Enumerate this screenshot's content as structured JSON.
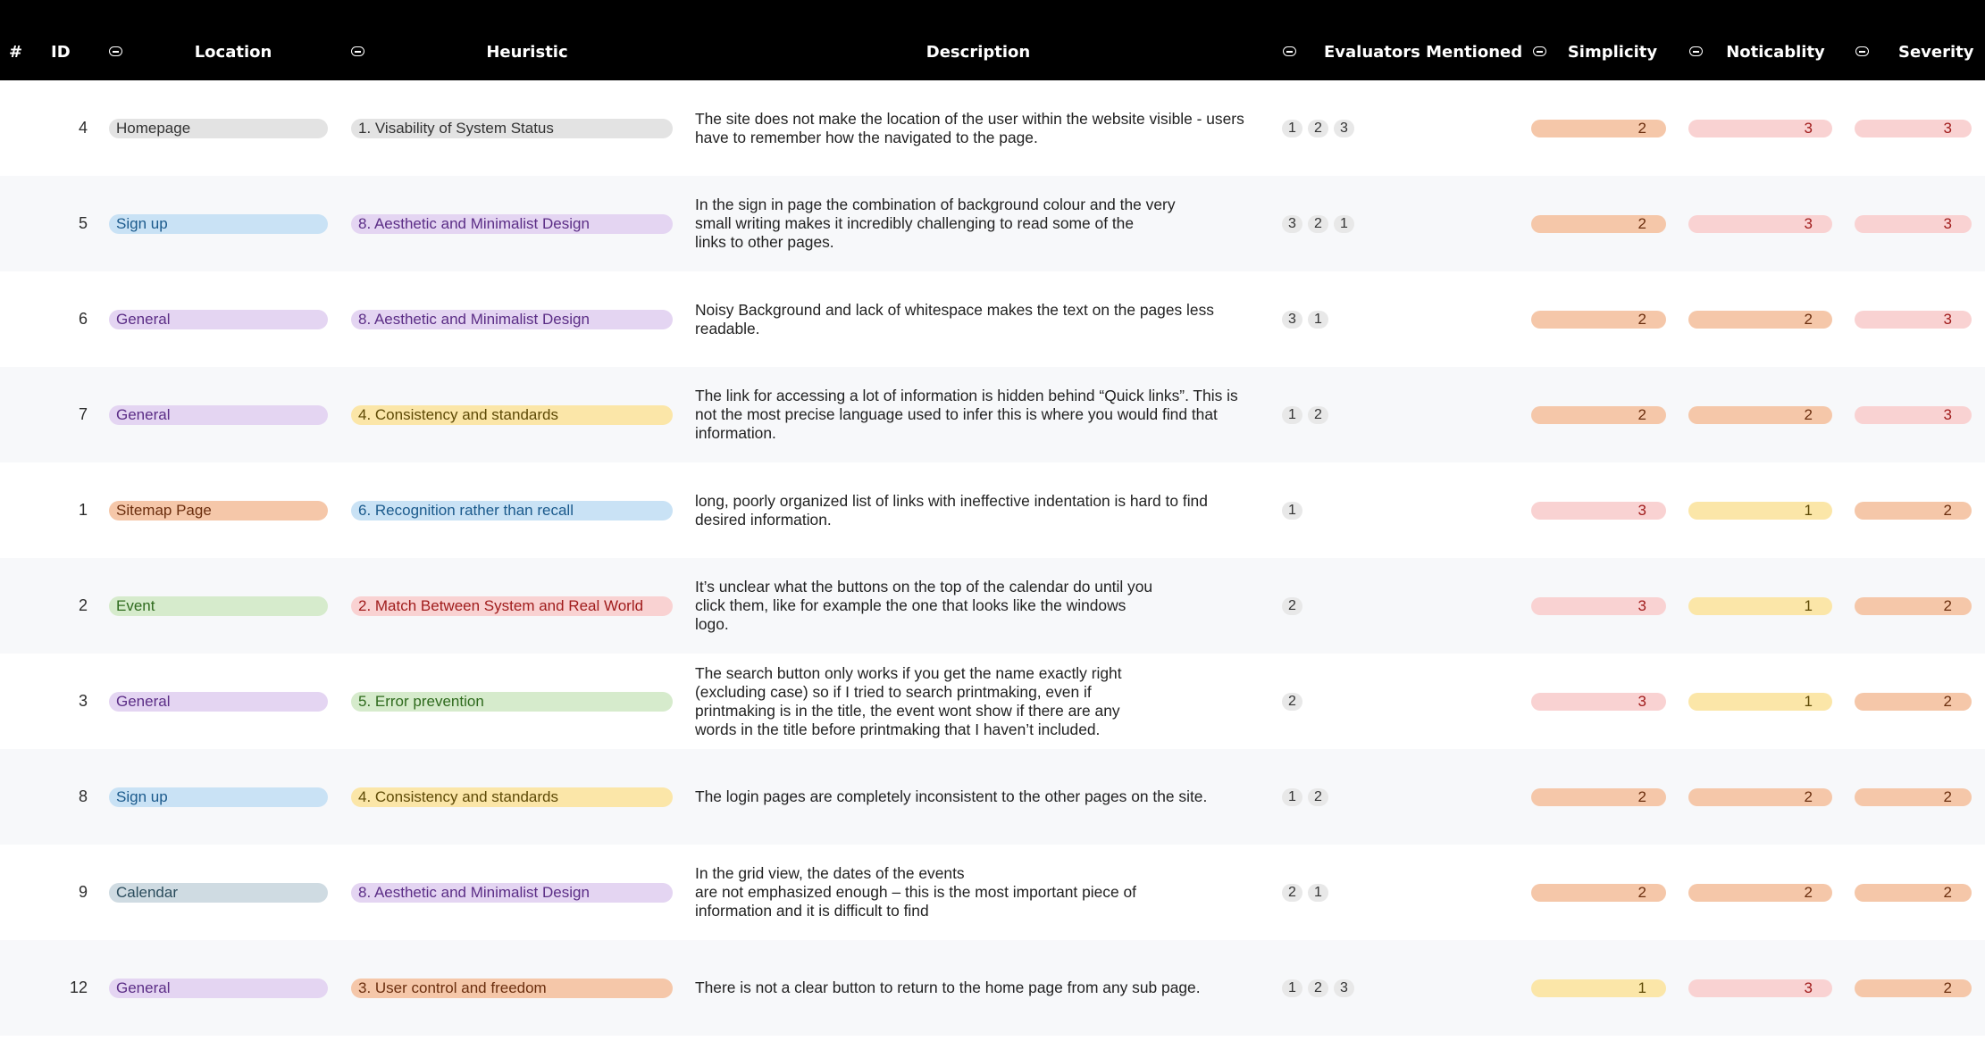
{
  "header": {
    "hash": "#",
    "id": "ID",
    "location": "Location",
    "heuristic": "Heuristic",
    "description": "Description",
    "evaluators": "Evaluators Mentioned",
    "simplicity": "Simplicity",
    "noticability": "Noticablity",
    "severity": "Severity"
  },
  "rows": [
    {
      "id": "4",
      "location": {
        "label": "Homepage",
        "color": "#e3e3e3"
      },
      "heuristic": {
        "label": "1. Visability of System Status",
        "color": "#e3e3e3"
      },
      "description": "The site does not make the location of the user within the website visible - users\nhave to remember how the navigated to the page.",
      "evaluators": [
        "1",
        "2",
        "3"
      ],
      "simplicity": "2",
      "noticability": "3",
      "severity": "3"
    },
    {
      "id": "5",
      "location": {
        "label": "Sign up",
        "color": "#c9e2f5"
      },
      "heuristic": {
        "label": "8. Aesthetic and Minimalist Design",
        "color": "#e4d5f2"
      },
      "description": "In the sign in page the combination of background colour and the very\nsmall writing makes it incredibly challenging to read some of the\nlinks to other pages.",
      "evaluators": [
        "3",
        "2",
        "1"
      ],
      "simplicity": "2",
      "noticability": "3",
      "severity": "3"
    },
    {
      "id": "6",
      "location": {
        "label": "General",
        "color": "#e4d5f2"
      },
      "heuristic": {
        "label": "8. Aesthetic and Minimalist Design",
        "color": "#e4d5f2"
      },
      "description": "Noisy Background and lack of whitespace makes the text on the pages less\nreadable.",
      "evaluators": [
        "3",
        "1"
      ],
      "simplicity": "2",
      "noticability": "2",
      "severity": "3"
    },
    {
      "id": "7",
      "location": {
        "label": "General",
        "color": "#e4d5f2"
      },
      "heuristic": {
        "label": "4. Consistency and standards",
        "color": "#fbe6a8"
      },
      "description": "The link for accessing a lot of information is hidden behind “Quick links”. This is\nnot the most precise language used to infer this is where you would find that\ninformation.",
      "evaluators": [
        "1",
        "2"
      ],
      "simplicity": "2",
      "noticability": "2",
      "severity": "3"
    },
    {
      "id": "1",
      "location": {
        "label": "Sitemap Page",
        "color": "#f5c7a9"
      },
      "heuristic": {
        "label": "6. Recognition rather than recall",
        "color": "#c9e2f5"
      },
      "description": "long, poorly organized list of links with ineffective indentation is hard to find\ndesired information.",
      "evaluators": [
        "1"
      ],
      "simplicity": "3",
      "noticability": "1",
      "severity": "2"
    },
    {
      "id": "2",
      "location": {
        "label": "Event",
        "color": "#d6ebcc"
      },
      "heuristic": {
        "label": "2. Match Between System and Real World",
        "color": "#f9d2d2"
      },
      "description": "It’s unclear what the buttons on the top of the calendar do until you\nclick them, like for example the one that looks like the windows\nlogo.",
      "evaluators": [
        "2"
      ],
      "simplicity": "3",
      "noticability": "1",
      "severity": "2"
    },
    {
      "id": "3",
      "location": {
        "label": "General",
        "color": "#e4d5f2"
      },
      "heuristic": {
        "label": "5. Error prevention",
        "color": "#d6ebcc"
      },
      "description": "The search button only works if you get the name exactly right\n(excluding case) so if I tried to search printmaking, even if\nprintmaking is in the title, the event wont show if there are any\nwords in the title before printmaking that I haven’t included.",
      "evaluators": [
        "2"
      ],
      "simplicity": "3",
      "noticability": "1",
      "severity": "2"
    },
    {
      "id": "8",
      "location": {
        "label": "Sign up",
        "color": "#c9e2f5"
      },
      "heuristic": {
        "label": "4. Consistency and standards",
        "color": "#fbe6a8"
      },
      "description": "The login pages are completely inconsistent to the other pages on the site.",
      "evaluators": [
        "1",
        "2"
      ],
      "simplicity": "2",
      "noticability": "2",
      "severity": "2"
    },
    {
      "id": "9",
      "location": {
        "label": "Calendar",
        "color": "#cfdbe2"
      },
      "heuristic": {
        "label": "8. Aesthetic and Minimalist Design",
        "color": "#e4d5f2"
      },
      "description": "In the grid view, the dates of the events\nare not emphasized enough – this is the most important piece of\ninformation and it is difficult to find",
      "evaluators": [
        "2",
        "1"
      ],
      "simplicity": "2",
      "noticability": "2",
      "severity": "2"
    },
    {
      "id": "12",
      "location": {
        "label": "General",
        "color": "#e4d5f2"
      },
      "heuristic": {
        "label": "3. User control and freedom",
        "color": "#f5c7a9"
      },
      "description": "There is not a clear button to return to the home page from any sub page.",
      "evaluators": [
        "1",
        "2",
        "3"
      ],
      "simplicity": "1",
      "noticability": "3",
      "severity": "2"
    }
  ]
}
